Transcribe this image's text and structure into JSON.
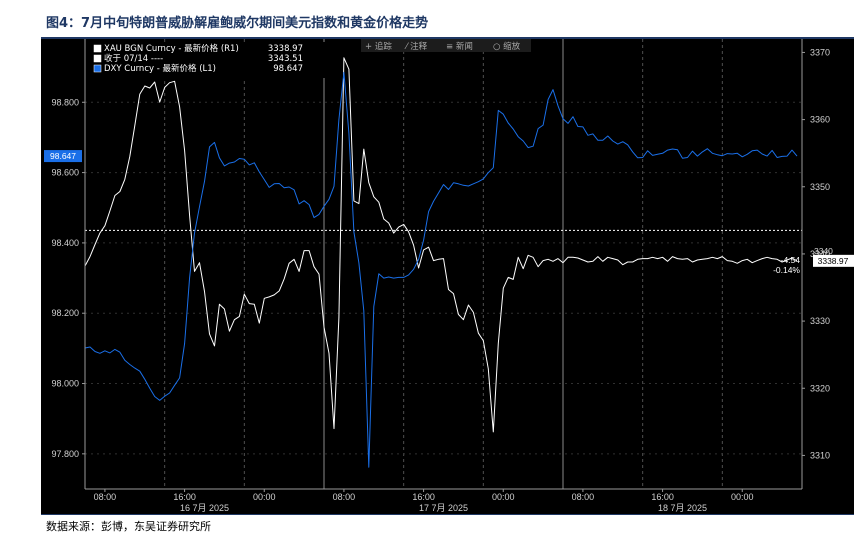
{
  "title": "图4：7月中旬特朗普威胁解雇鲍威尔期间美元指数和黄金价格走势",
  "source": "数据来源：彭博，东吴证券研究所",
  "toolbar": [
    "+ 追踪",
    "⁄ 注释",
    "≡ 新闻",
    "○ 缩放"
  ],
  "colors": {
    "gold": "#ffffff",
    "dxy": "#1a6fe8",
    "background": "#000000",
    "grid": "#5a5a5a",
    "title": "#1f3864"
  },
  "chart_data": {
    "type": "line",
    "x_day_labels": [
      "16 7月 2025",
      "17 7月 2025",
      "18 7月 2025"
    ],
    "x_tick_labels": [
      "08:00",
      "16:00",
      "00:00",
      "08:00",
      "16:00",
      "00:00",
      "08:00",
      "16:00",
      "00:00"
    ],
    "y_left": {
      "ticks": [
        "98.800",
        "98.600",
        "98.400",
        "98.200",
        "98.000",
        "97.800"
      ],
      "range": [
        97.7,
        98.98
      ]
    },
    "y_right": {
      "ticks": [
        "3370",
        "3360",
        "3350",
        "3340",
        "3330",
        "3320",
        "3310"
      ],
      "range": [
        3305,
        3372
      ]
    },
    "legend": [
      {
        "label": "XAU BGN Curncy - 最新价格 (R1)",
        "value": "3338.97",
        "color": "#ffffff"
      },
      {
        "label": "收于 07/14 ----",
        "value": "3343.51",
        "color": "#ffffff"
      },
      {
        "label": "DXY Curncy - 最新价格 (L1)",
        "value": "98.647",
        "color": "#1a6fe8"
      }
    ],
    "reference_line": {
      "label": "收于 07/14",
      "value": 3343.51
    },
    "flags": {
      "dxy_last": "98.647",
      "xau_last": "3338.97",
      "xau_change": "-4.54",
      "xau_change_pct": "-0.14%",
      "xau_partial_label": "3340"
    },
    "series": [
      {
        "name": "XAU BGN Curncy",
        "axis": "right",
        "color": "#ffffff",
        "x": [
          0.0,
          0.5,
          1.0,
          1.5,
          2.0,
          2.5,
          3.0,
          3.5,
          4.0,
          4.5,
          5.0,
          5.5,
          6.0,
          6.5,
          7.0,
          7.5,
          8.0,
          8.5,
          9.0,
          9.5,
          10.0,
          10.5,
          11.0,
          11.5,
          12.0,
          12.5,
          13.0,
          13.5,
          14.0,
          14.5,
          15.0,
          15.5,
          16.0,
          16.5,
          17.0,
          17.5,
          18.0,
          18.5,
          19.0,
          19.5,
          20.0,
          20.5,
          21.0,
          21.5,
          22.0,
          22.5,
          23.0,
          23.5,
          24.0,
          24.5,
          25.0,
          25.5,
          26.0,
          26.5,
          27.0,
          27.5,
          28.0,
          28.5,
          29.0,
          29.5,
          30.0,
          30.5,
          31.0,
          31.5,
          32.0,
          32.5,
          33.0,
          33.5,
          34.0,
          34.5,
          35.0,
          35.5,
          36.0,
          36.5,
          37.0,
          37.5,
          38.0,
          38.5,
          39.0,
          39.5,
          40.0,
          40.5,
          41.0,
          41.5,
          42.0,
          42.5,
          43.0,
          43.5,
          44.0,
          44.5,
          45.0,
          45.5,
          46.0,
          46.5,
          47.0,
          47.5,
          48.0,
          48.5,
          49.0,
          49.5,
          50.0,
          50.5,
          51.0,
          51.5,
          52.0,
          52.5,
          53.0,
          53.5,
          54.0,
          54.5,
          55.0,
          55.5,
          56.0,
          56.5,
          57.0,
          57.5,
          58.0,
          58.5,
          59.0,
          59.5,
          60.0,
          60.5,
          61.0,
          61.5,
          62.0,
          62.5,
          63.0,
          63.5,
          64.0,
          64.5,
          65.0,
          65.5,
          66.0,
          66.5,
          67.0,
          67.5,
          68.0,
          68.5,
          69.0,
          69.5,
          70.0,
          70.5,
          71.0,
          71.5
        ],
        "values": [
          3338.2,
          3339.6,
          3341.4,
          3343.1,
          3344.2,
          3346.4,
          3348.7,
          3349.3,
          3351.1,
          3354.5,
          3359.1,
          3363.8,
          3365.0,
          3364.7,
          3365.6,
          3362.6,
          3364.8,
          3365.5,
          3365.7,
          3361.9,
          3355.4,
          3345.7,
          3337.4,
          3338.7,
          3334.4,
          3328.1,
          3326.3,
          3332.5,
          3331.8,
          3328.5,
          3330.2,
          3330.7,
          3334.0,
          3332.6,
          3332.5,
          3329.7,
          3333.4,
          3333.6,
          3333.9,
          3334.5,
          3336.3,
          3338.6,
          3339.2,
          3337.4,
          3340.5,
          3340.5,
          3338.1,
          3337.0,
          3329.1,
          3325.2,
          3314.0,
          3330.5,
          3369.2,
          3367.5,
          3347.9,
          3347.5,
          3355.6,
          3350.6,
          3348.5,
          3347.7,
          3345.2,
          3344.6,
          3343.1,
          3344.0,
          3344.4,
          3343.3,
          3341.3,
          3337.9,
          3340.6,
          3341.0,
          3339.0,
          3339.2,
          3339.3,
          3334.7,
          3334.1,
          3331.0,
          3330.2,
          3332.4,
          3331.3,
          3328.2,
          3327.1,
          3322.9,
          3313.5,
          3326.7,
          3334.9,
          3336.5,
          3336.2,
          3339.5,
          3337.8,
          3339.8,
          3339.5,
          3338.1,
          3339.0,
          3339.2,
          3338.9,
          3339.3,
          3338.7,
          3339.5,
          3339.5,
          3339.4,
          3339.1,
          3338.8,
          3338.9,
          3339.6,
          3338.9,
          3339.5,
          3339.3,
          3339.1,
          3338.4,
          3338.8,
          3338.8,
          3339.2,
          3339.3,
          3339.3,
          3339.5,
          3339.3,
          3339.5,
          3338.9,
          3339.6,
          3339.3,
          3339.2,
          3339.3,
          3338.8,
          3339.1,
          3339.2,
          3339.3,
          3339.5,
          3339.3,
          3339.6,
          3339.0,
          3338.9,
          3338.6,
          3339.0,
          3339.2,
          3338.7,
          3339.0,
          3339.3,
          3339.5,
          3339.3,
          3339.2,
          3338.8,
          3339.1,
          3339.4,
          3338.97
        ]
      },
      {
        "name": "DXY Curncy",
        "axis": "left",
        "color": "#1a6fe8",
        "x": [
          0.0,
          0.5,
          1.0,
          1.5,
          2.0,
          2.5,
          3.0,
          3.5,
          4.0,
          4.5,
          5.0,
          5.5,
          6.0,
          6.5,
          7.0,
          7.5,
          8.0,
          8.5,
          9.0,
          9.5,
          10.0,
          10.5,
          11.0,
          11.5,
          12.0,
          12.5,
          13.0,
          13.5,
          14.0,
          14.5,
          15.0,
          15.5,
          16.0,
          16.5,
          17.0,
          17.5,
          18.0,
          18.5,
          19.0,
          19.5,
          20.0,
          20.5,
          21.0,
          21.5,
          22.0,
          22.5,
          23.0,
          23.5,
          24.0,
          24.5,
          25.0,
          25.5,
          26.0,
          26.5,
          27.0,
          27.5,
          28.0,
          28.5,
          29.0,
          29.5,
          30.0,
          30.5,
          31.0,
          31.5,
          32.0,
          32.5,
          33.0,
          33.5,
          34.0,
          34.5,
          35.0,
          35.5,
          36.0,
          36.5,
          37.0,
          37.5,
          38.0,
          38.5,
          39.0,
          39.5,
          40.0,
          40.5,
          41.0,
          41.5,
          42.0,
          42.5,
          43.0,
          43.5,
          44.0,
          44.5,
          45.0,
          45.5,
          46.0,
          46.5,
          47.0,
          47.5,
          48.0,
          48.5,
          49.0,
          49.5,
          50.0,
          50.5,
          51.0,
          51.5,
          52.0,
          52.5,
          53.0,
          53.5,
          54.0,
          54.5,
          55.0,
          55.5,
          56.0,
          56.5,
          57.0,
          57.5,
          58.0,
          58.5,
          59.0,
          59.5,
          60.0,
          60.5,
          61.0,
          61.5,
          62.0,
          62.5,
          63.0,
          63.5,
          64.0,
          64.5,
          65.0,
          65.5,
          66.0,
          66.5,
          67.0,
          67.5,
          68.0,
          68.5,
          69.0,
          69.5,
          70.0,
          70.5,
          71.0,
          71.5
        ],
        "values": [
          98.101,
          98.104,
          98.091,
          98.086,
          98.093,
          98.087,
          98.097,
          98.089,
          98.066,
          98.054,
          98.044,
          98.035,
          98.012,
          97.987,
          97.963,
          97.952,
          97.964,
          97.973,
          97.995,
          98.016,
          98.114,
          98.301,
          98.428,
          98.503,
          98.575,
          98.673,
          98.686,
          98.642,
          98.619,
          98.627,
          98.63,
          98.64,
          98.638,
          98.622,
          98.628,
          98.602,
          98.58,
          98.558,
          98.568,
          98.569,
          98.557,
          98.559,
          98.551,
          98.511,
          98.52,
          98.509,
          98.472,
          98.481,
          98.504,
          98.524,
          98.561,
          98.751,
          98.885,
          98.712,
          98.431,
          98.343,
          98.207,
          97.762,
          98.219,
          98.312,
          98.3,
          98.303,
          98.3,
          98.302,
          98.302,
          98.309,
          98.325,
          98.353,
          98.408,
          98.489,
          98.518,
          98.542,
          98.566,
          98.552,
          98.571,
          98.568,
          98.564,
          98.562,
          98.568,
          98.574,
          98.582,
          98.6,
          98.614,
          98.777,
          98.766,
          98.741,
          98.724,
          98.702,
          98.69,
          98.671,
          98.675,
          98.725,
          98.735,
          98.808,
          98.836,
          98.79,
          98.753,
          98.74,
          98.759,
          98.731,
          98.73,
          98.706,
          98.71,
          98.692,
          98.692,
          98.704,
          98.69,
          98.681,
          98.688,
          98.679,
          98.659,
          98.642,
          98.643,
          98.662,
          98.649,
          98.652,
          98.655,
          98.664,
          98.667,
          98.665,
          98.641,
          98.643,
          98.661,
          98.647,
          98.659,
          98.668,
          98.655,
          98.651,
          98.648,
          98.654,
          98.653,
          98.655,
          98.645,
          98.652,
          98.662,
          98.664,
          98.653,
          98.647,
          98.663,
          98.643,
          98.646,
          98.647,
          98.664,
          98.647
        ]
      }
    ]
  }
}
